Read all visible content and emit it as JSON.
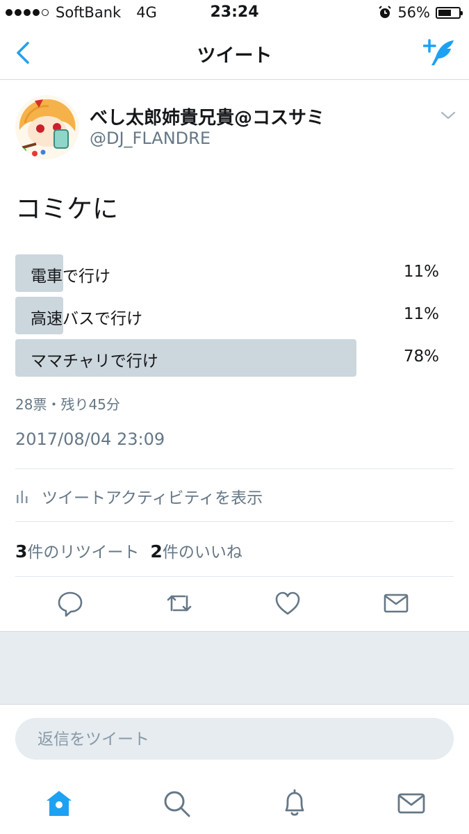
{
  "status_bar": {
    "carrier": "SoftBank",
    "network": "4G",
    "time": "23:24",
    "battery": "56%"
  },
  "nav": {
    "title": "ツイート"
  },
  "tweet": {
    "display_name": "べし太郎姉貴兄貴@コスサミ",
    "handle": "@DJ_FLANDRE",
    "text": "コミケに",
    "poll": {
      "options": [
        {
          "label": "電車で行け",
          "percent": "11%",
          "fraction": 0.11
        },
        {
          "label": "高速バスで行け",
          "percent": "11%",
          "fraction": 0.11
        },
        {
          "label": "ママチャリで行け",
          "percent": "78%",
          "fraction": 0.78
        }
      ],
      "meta": "28票・残り45分"
    },
    "timestamp": "2017/08/04 23:09",
    "activity_label": "ツイートアクティビティを表示",
    "retweet_count": "3",
    "retweet_label": "件のリツイート",
    "like_count": "2",
    "like_label": "件のいいね"
  },
  "reply": {
    "placeholder": "返信をツイート"
  },
  "colors": {
    "accent": "#1da1f2",
    "poll_bar": "#ccd6dd",
    "muted": "#657786"
  },
  "icons": [
    "back-icon",
    "compose-tweet-icon",
    "chevron-down-icon",
    "bar-chart-icon",
    "reply-icon",
    "retweet-icon",
    "like-icon",
    "message-icon",
    "home-icon",
    "search-icon",
    "notifications-icon",
    "messages-icon"
  ]
}
